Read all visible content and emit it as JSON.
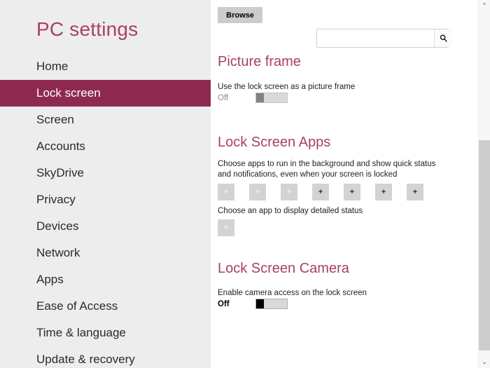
{
  "sidebar": {
    "title": "PC settings",
    "accent_color": "#8e2a50",
    "title_color": "#a8415f",
    "background_color": "#ededed",
    "items": [
      {
        "label": "Home",
        "selected": false
      },
      {
        "label": "Lock screen",
        "selected": true
      },
      {
        "label": "Screen",
        "selected": false
      },
      {
        "label": "Accounts",
        "selected": false
      },
      {
        "label": "SkyDrive",
        "selected": false
      },
      {
        "label": "Privacy",
        "selected": false
      },
      {
        "label": "Devices",
        "selected": false
      },
      {
        "label": "Network",
        "selected": false
      },
      {
        "label": "Apps",
        "selected": false
      },
      {
        "label": "Ease of Access",
        "selected": false
      },
      {
        "label": "Time & language",
        "selected": false
      },
      {
        "label": "Update & recovery",
        "selected": false
      }
    ]
  },
  "content": {
    "browse_button_label": "Browse",
    "search": {
      "value": "",
      "placeholder": "",
      "icon": "search-icon"
    },
    "picture_frame": {
      "heading": "Picture frame",
      "description": "Use the lock screen as a picture frame",
      "toggle_state_label": "Off"
    },
    "lock_screen_apps": {
      "heading": "Lock Screen Apps",
      "description": "Choose apps to run in the background and show quick status and notifications, even when your screen is locked",
      "tiles": [
        {
          "glyph": "+",
          "dark": false
        },
        {
          "glyph": "+",
          "dark": false
        },
        {
          "glyph": "+",
          "dark": false
        },
        {
          "glyph": "+",
          "dark": true
        },
        {
          "glyph": "+",
          "dark": true
        },
        {
          "glyph": "+",
          "dark": true
        },
        {
          "glyph": "+",
          "dark": true
        }
      ],
      "detailed_status_label": "Choose an app to display detailed status",
      "detailed_status_tile": {
        "glyph": "+",
        "dark": false
      }
    },
    "lock_screen_camera": {
      "heading": "Lock Screen Camera",
      "description": "Enable camera access on the lock screen",
      "toggle_state_label": "Off"
    }
  },
  "scrollbar": {
    "up_arrow": "scroll-up-icon",
    "down_arrow": "scroll-down-icon",
    "up_glyph": "⌃",
    "down_glyph": "⌄"
  }
}
